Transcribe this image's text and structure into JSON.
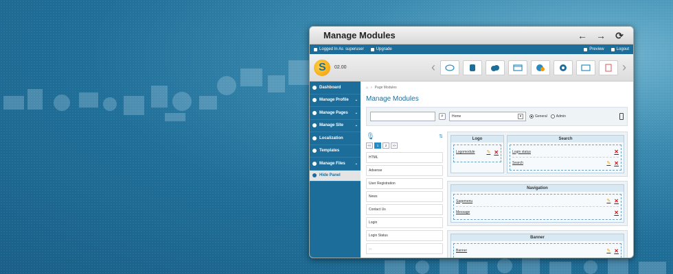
{
  "window": {
    "title": "Manage Modules",
    "nav": [
      "←",
      "→",
      "⟳"
    ]
  },
  "topbar": {
    "logged_in_label": "Logged In As",
    "username": "superuser",
    "upgrade": "Upgrade",
    "preview": "Preview",
    "logout": "Logout"
  },
  "toolbar": {
    "version": "02.00",
    "icons": [
      "modules-icon",
      "database-icon",
      "cloud-icon",
      "window-icon",
      "theme-icon",
      "gear-icon",
      "card-icon",
      "document-icon"
    ]
  },
  "sidebar": {
    "items": [
      {
        "label": "Dashboard",
        "has_chevron": false
      },
      {
        "label": "Manage Profile",
        "has_chevron": true
      },
      {
        "label": "Manage Pages",
        "has_chevron": true
      },
      {
        "label": "Manage Site",
        "has_chevron": true
      },
      {
        "label": "Localization",
        "has_chevron": false
      },
      {
        "label": "Templates",
        "has_chevron": false
      },
      {
        "label": "Manage Files",
        "has_chevron": true
      }
    ],
    "hide_panel": "Hide Panel"
  },
  "main": {
    "breadcrumb": "Page Modules",
    "title": "Manage Modules",
    "search_value": "",
    "page_select": "Home",
    "radio_general": "General",
    "radio_admin": "Admin",
    "pager": {
      "prev": "<<",
      "pages": [
        "1",
        "2"
      ],
      "next": ">>"
    },
    "modules": [
      "HTML",
      "Adsense",
      "User Registration",
      "News",
      "Contact Us",
      "Login",
      "Login Status",
      "..."
    ],
    "zones": {
      "logo": {
        "title": "Logo",
        "items": [
          "Logomodule"
        ]
      },
      "search": {
        "title": "Search",
        "items": [
          "Login status",
          "Search"
        ]
      },
      "navigation": {
        "title": "Navigation",
        "items": [
          "Sagemenu",
          "Message"
        ]
      },
      "banner": {
        "title": "Banner",
        "items": [
          "Banner"
        ]
      }
    }
  }
}
